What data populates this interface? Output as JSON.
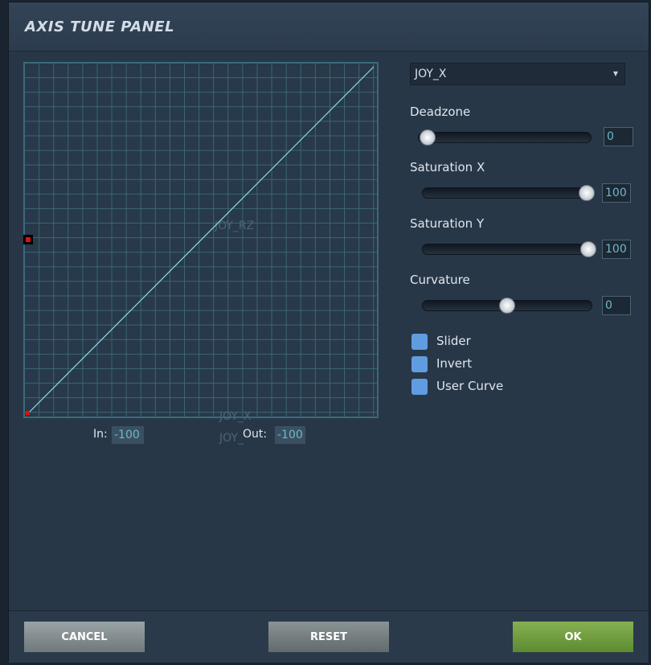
{
  "window": {
    "title": "AXIS TUNE PANEL"
  },
  "graph": {
    "watermark_label": "JOY_RZ",
    "overlay_label_1": "JOY_X",
    "overlay_label_2": "JOY_"
  },
  "io": {
    "in_label": "In:",
    "in_value": "-100",
    "out_label": "Out:",
    "out_value": "-100"
  },
  "axis_select": {
    "selected": "JOY_X"
  },
  "controls": {
    "deadzone": {
      "label": "Deadzone",
      "value": "0",
      "level": 0
    },
    "saturation_x": {
      "label": "Saturation X",
      "value": "100",
      "level": 1
    },
    "saturation_y": {
      "label": "Saturation Y",
      "value": "100",
      "level": 1
    },
    "curvature": {
      "label": "Curvature",
      "value": "0",
      "level": 0.5
    }
  },
  "checks": [
    {
      "label": "Slider"
    },
    {
      "label": "Invert"
    },
    {
      "label": "User Curve"
    }
  ],
  "buttons": {
    "cancel": "CANCEL",
    "reset": "RESET",
    "ok": "OK"
  },
  "colors": {
    "accent_ok": "#6f9e3d",
    "curve": "#8fd8ea",
    "checkbox": "#5f9de0",
    "value_text": "#6fb7c9"
  }
}
